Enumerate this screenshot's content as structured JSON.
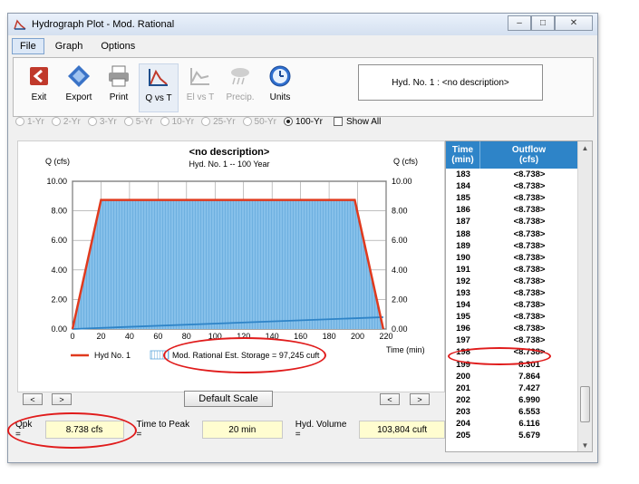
{
  "window": {
    "title": "Hydrograph Plot - Mod. Rational",
    "buttons": {
      "minimize": "–",
      "maximize": "□",
      "close": "✕"
    }
  },
  "menu": [
    "File",
    "Graph",
    "Options"
  ],
  "toolbar": {
    "tools": [
      {
        "label": "Exit",
        "icon": "exit-icon"
      },
      {
        "label": "Export",
        "icon": "export-icon"
      },
      {
        "label": "Print",
        "icon": "printer-icon"
      },
      {
        "label": "Q vs T",
        "icon": "q-vs-t-icon"
      },
      {
        "label": "El vs T",
        "icon": "el-vs-t-icon"
      },
      {
        "label": "Precip.",
        "icon": "precip-icon"
      },
      {
        "label": "Units",
        "icon": "clock-icon"
      }
    ],
    "hyd_label": "Hyd. No. 1 : <no description>"
  },
  "return_periods": {
    "options": [
      "1-Yr",
      "2-Yr",
      "3-Yr",
      "5-Yr",
      "10-Yr",
      "25-Yr",
      "50-Yr",
      "100-Yr"
    ],
    "selected": "100-Yr",
    "show_all_label": "Show All"
  },
  "chart_data": {
    "type": "area",
    "title": "<no description>",
    "subtitle": "Hyd. No. 1 -- 100 Year",
    "ylabel_left": "Q (cfs)",
    "ylabel_right": "Q (cfs)",
    "xlabel": "Time (min)",
    "xlim": [
      0,
      220
    ],
    "ylim": [
      0,
      10
    ],
    "x_ticks": [
      0,
      20,
      40,
      60,
      80,
      100,
      120,
      140,
      160,
      180,
      200,
      220
    ],
    "y_ticks": [
      "0.00",
      "2.00",
      "4.00",
      "6.00",
      "8.00",
      "10.00"
    ],
    "grid": true,
    "series": [
      {
        "name": "Hyd No. 1",
        "color": "#e03a1e",
        "x": [
          0,
          20,
          198,
          218
        ],
        "y": [
          0,
          8.738,
          8.738,
          0
        ]
      },
      {
        "name": "Mod. Rational Est. Storage = 97,245 cuft",
        "color": "#5fa8dd",
        "x": [
          0,
          20,
          198,
          218
        ],
        "y": [
          0,
          8.738,
          8.738,
          0
        ]
      }
    ],
    "inflow_line": {
      "x": [
        0,
        218
      ],
      "y": [
        0,
        0.8
      ],
      "color": "#2e84c8"
    },
    "legend": [
      {
        "label": "Hyd No. 1",
        "type": "line",
        "color": "#e03a1e"
      },
      {
        "label": "Mod. Rational Est. Storage = 97,245 cuft",
        "type": "hatch",
        "color": "#5fa8dd"
      }
    ]
  },
  "controls": {
    "left_prev": "<",
    "left_next": ">",
    "default_scale": "Default Scale",
    "right_prev": "<",
    "right_next": ">"
  },
  "stats": {
    "qpk_label": "Qpk =",
    "qpk_value": "8.738 cfs",
    "ttp_label": "Time to Peak =",
    "ttp_value": "20 min",
    "vol_label": "Hyd. Volume =",
    "vol_value": "103,804 cuft"
  },
  "table": {
    "headers": [
      "Time\n(min)",
      "Outflow\n(cfs)"
    ],
    "rows": [
      [
        "183",
        "<8.738>"
      ],
      [
        "184",
        "<8.738>"
      ],
      [
        "185",
        "<8.738>"
      ],
      [
        "186",
        "<8.738>"
      ],
      [
        "187",
        "<8.738>"
      ],
      [
        "188",
        "<8.738>"
      ],
      [
        "189",
        "<8.738>"
      ],
      [
        "190",
        "<8.738>"
      ],
      [
        "191",
        "<8.738>"
      ],
      [
        "192",
        "<8.738>"
      ],
      [
        "193",
        "<8.738>"
      ],
      [
        "194",
        "<8.738>"
      ],
      [
        "195",
        "<8.738>"
      ],
      [
        "196",
        "<8.738>"
      ],
      [
        "197",
        "<8.738>"
      ],
      [
        "198",
        "<8.738>"
      ],
      [
        "199",
        "8.301"
      ],
      [
        "200",
        "7.864"
      ],
      [
        "201",
        "7.427"
      ],
      [
        "202",
        "6.990"
      ],
      [
        "203",
        "6.553"
      ],
      [
        "204",
        "6.116"
      ],
      [
        "205",
        "5.679"
      ]
    ]
  }
}
